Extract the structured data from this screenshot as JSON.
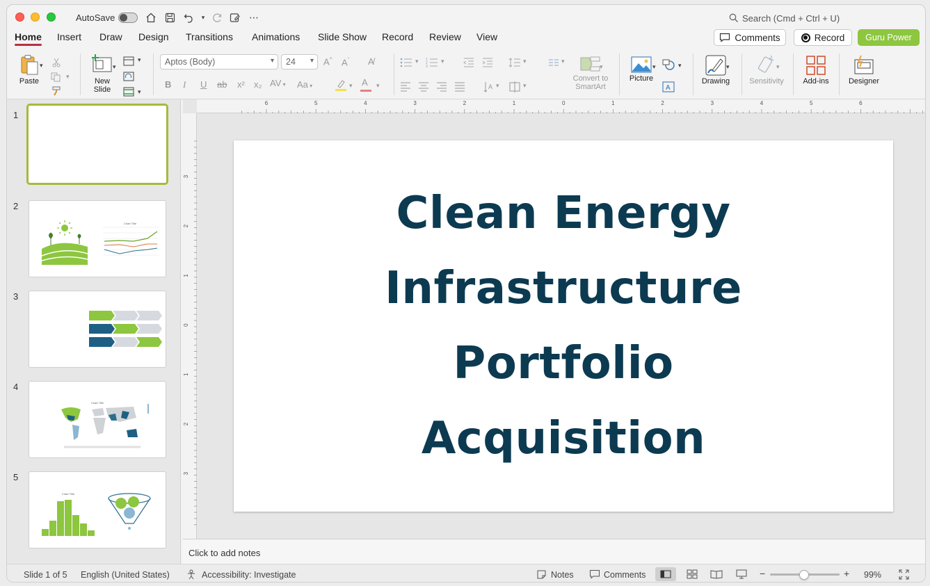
{
  "titlebar": {
    "autosave_label": "AutoSave",
    "search_placeholder": "Search (Cmd + Ctrl + U)"
  },
  "tabs": [
    "Home",
    "Insert",
    "Draw",
    "Design",
    "Transitions",
    "Animations",
    "Slide Show",
    "Record",
    "Review",
    "View"
  ],
  "actions": {
    "comments_label": "Comments",
    "record_label": "Record",
    "guru_label": "Guru Power"
  },
  "ribbon": {
    "paste_label": "Paste",
    "new_slide_label": "New Slide",
    "font_name": "Aptos (Body)",
    "font_size": "24",
    "convert_smartart_label": "Convert to SmartArt",
    "picture_label": "Picture",
    "drawing_label": "Drawing",
    "sensitivity_label": "Sensitivity",
    "addins_label": "Add-ins",
    "designer_label": "Designer"
  },
  "slides": [
    {
      "number": "1"
    },
    {
      "number": "2"
    },
    {
      "number": "3"
    },
    {
      "number": "4"
    },
    {
      "number": "5"
    }
  ],
  "thumbnails": {
    "chart_title": "Chart Title"
  },
  "slide": {
    "title_lines": [
      "Clean Energy",
      "Infrastructure",
      "Portfolio",
      "Acquisition"
    ]
  },
  "notes_placeholder": "Click to add notes",
  "status": {
    "slide_info": "Slide 1 of 5",
    "language": "English (United States)",
    "accessibility": "Accessibility: Investigate",
    "notes_label": "Notes",
    "comments_label": "Comments",
    "zoom": "99%"
  },
  "ruler": {
    "h_ticks": [
      "6",
      "5",
      "4",
      "3",
      "2",
      "1",
      "0",
      "1",
      "2",
      "3",
      "4",
      "5",
      "6"
    ],
    "v_ticks": [
      "3",
      "2",
      "1",
      "0",
      "1",
      "2",
      "3"
    ]
  },
  "colors": {
    "accent_green": "#8dc63f",
    "title_navy": "#0c3a51",
    "selection_green": "#a6ba3a",
    "tab_underline": "#b9303f"
  }
}
